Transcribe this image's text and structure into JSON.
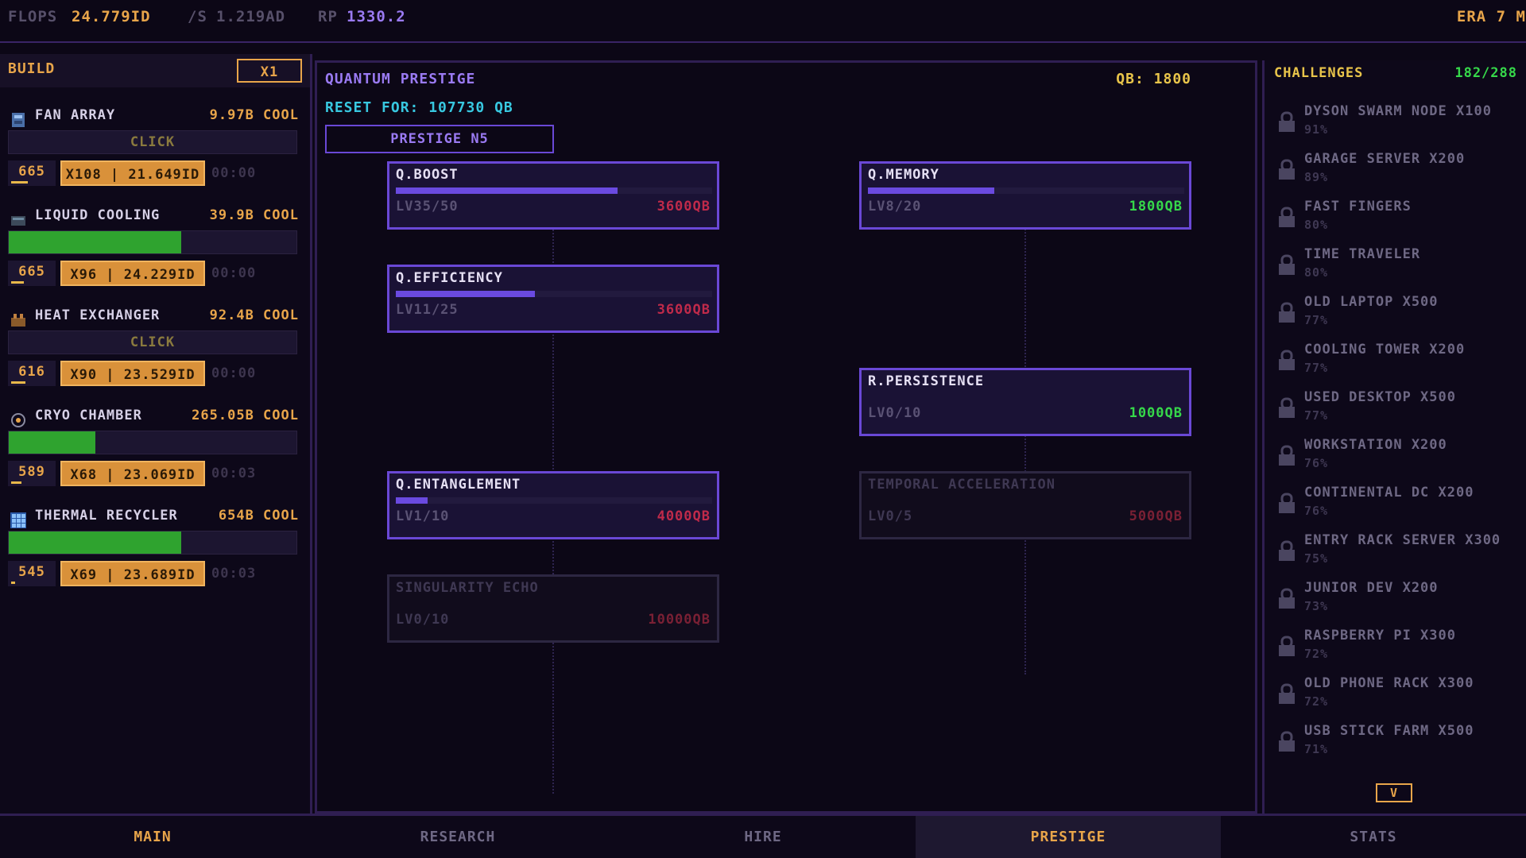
{
  "topbar": {
    "flops_label": "FLOPS",
    "flops_value": "24.779ID",
    "rate_label": "/S",
    "rate_value": "1.219AD",
    "rp_label": "RP",
    "rp_value": "1330.2",
    "era": "ERA 7 M"
  },
  "build": {
    "title": "BUILD",
    "multiplier": "X1",
    "items": [
      {
        "name": "FAN ARRAY",
        "cool": "9.97B COOL",
        "mode": "click",
        "click_label": "CLICK",
        "fill": 0,
        "count": "665",
        "count_fill": 0.4,
        "buy": "X108 | 21.649ID",
        "timer": "00:00",
        "icon": "fan-icon"
      },
      {
        "name": "LIQUID COOLING",
        "cool": "39.9B COOL",
        "mode": "bar",
        "click_label": "",
        "fill": 0.6,
        "count": "665",
        "count_fill": 0.3,
        "buy": "X96 | 24.229ID",
        "timer": "00:00",
        "icon": "droplet-icon"
      },
      {
        "name": "HEAT EXCHANGER",
        "cool": "92.4B COOL",
        "mode": "click",
        "click_label": "CLICK",
        "fill": 0,
        "count": "616",
        "count_fill": 0.35,
        "buy": "X90 | 23.529ID",
        "timer": "00:00",
        "icon": "exchanger-icon"
      },
      {
        "name": "CRYO CHAMBER",
        "cool": "265.05B COOL",
        "mode": "bar",
        "click_label": "",
        "fill": 0.3,
        "count": "589",
        "count_fill": 0.25,
        "buy": "X68 | 23.069ID",
        "timer": "00:03",
        "icon": "snowflake-icon"
      },
      {
        "name": "THERMAL RECYCLER",
        "cool": "654B COOL",
        "mode": "bar",
        "click_label": "",
        "fill": 0.6,
        "count": "545",
        "count_fill": 0.1,
        "buy": "X69 | 23.689ID",
        "timer": "00:03",
        "icon": "grid-icon"
      }
    ]
  },
  "prestige": {
    "title": "QUANTUM PRESTIGE",
    "qb": "QB: 1800",
    "reset_for": "RESET FOR: 107730 QB",
    "button": "PRESTIGE N5",
    "nodes": [
      {
        "name": "Q.BOOST",
        "level": "LV35/50",
        "cost": "3600QB",
        "progress": 0.7,
        "affordable": false,
        "locked": false
      },
      {
        "name": "Q.MEMORY",
        "level": "LV8/20",
        "cost": "1800QB",
        "progress": 0.4,
        "affordable": true,
        "locked": false
      },
      {
        "name": "Q.EFFICIENCY",
        "level": "LV11/25",
        "cost": "3600QB",
        "progress": 0.44,
        "affordable": false,
        "locked": false
      },
      {
        "name": "R.PERSISTENCE",
        "level": "LV0/10",
        "cost": "1000QB",
        "progress": 0,
        "affordable": true,
        "locked": false
      },
      {
        "name": "Q.ENTANGLEMENT",
        "level": "LV1/10",
        "cost": "4000QB",
        "progress": 0.1,
        "affordable": false,
        "locked": false
      },
      {
        "name": "TEMPORAL ACCELERATION",
        "level": "LV0/5",
        "cost": "5000QB",
        "progress": 0,
        "affordable": false,
        "locked": true
      },
      {
        "name": "SINGULARITY ECHO",
        "level": "LV0/10",
        "cost": "10000QB",
        "progress": 0,
        "affordable": false,
        "locked": true
      }
    ]
  },
  "challenges": {
    "title": "CHALLENGES",
    "count": "182/288",
    "down_label": "V",
    "items": [
      {
        "name": "DYSON SWARM NODE X100",
        "pct": "91%"
      },
      {
        "name": "GARAGE SERVER X200",
        "pct": "89%"
      },
      {
        "name": "FAST FINGERS",
        "pct": "80%"
      },
      {
        "name": "TIME TRAVELER",
        "pct": "80%"
      },
      {
        "name": "OLD LAPTOP X500",
        "pct": "77%"
      },
      {
        "name": "COOLING TOWER X200",
        "pct": "77%"
      },
      {
        "name": "USED DESKTOP X500",
        "pct": "77%"
      },
      {
        "name": "WORKSTATION X200",
        "pct": "76%"
      },
      {
        "name": "CONTINENTAL DC X200",
        "pct": "76%"
      },
      {
        "name": "ENTRY RACK SERVER X300",
        "pct": "75%"
      },
      {
        "name": "JUNIOR DEV X200",
        "pct": "73%"
      },
      {
        "name": "RASPBERRY PI X300",
        "pct": "72%"
      },
      {
        "name": "OLD PHONE RACK X300",
        "pct": "72%"
      },
      {
        "name": "USB STICK FARM X500",
        "pct": "71%"
      }
    ]
  },
  "tabs": [
    {
      "label": "MAIN",
      "style": "gold"
    },
    {
      "label": "RESEARCH",
      "style": "normal"
    },
    {
      "label": "HIRE",
      "style": "normal"
    },
    {
      "label": "PRESTIGE",
      "style": "selected"
    },
    {
      "label": "STATS",
      "style": "normal"
    }
  ]
}
